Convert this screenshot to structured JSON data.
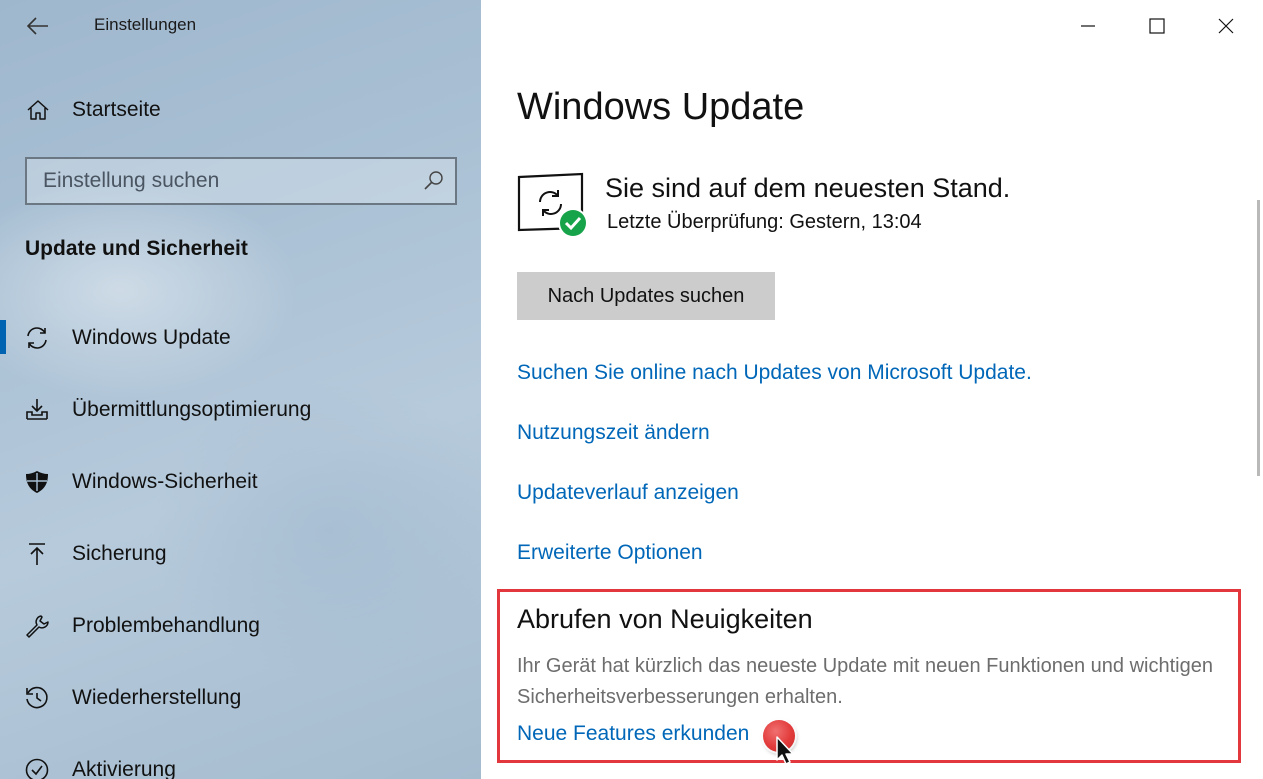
{
  "window": {
    "title": "Einstellungen",
    "controls": [
      "minimize-icon",
      "maximize-icon",
      "close-icon"
    ]
  },
  "sidebar": {
    "back_icon": "arrow-left-icon",
    "home": {
      "label": "Startseite",
      "icon": "home-icon"
    },
    "search": {
      "placeholder": "Einstellung suchen",
      "value": "",
      "icon": "search-icon"
    },
    "section_heading": "Update und Sicherheit",
    "items": [
      {
        "label": "Windows Update",
        "icon": "sync-icon",
        "active": true
      },
      {
        "label": "Übermittlungsoptimierung",
        "icon": "delivery-optimization-icon",
        "active": false
      },
      {
        "label": "Windows-Sicherheit",
        "icon": "shield-icon",
        "active": false
      },
      {
        "label": "Sicherung",
        "icon": "backup-arrow-icon",
        "active": false
      },
      {
        "label": "Problembehandlung",
        "icon": "wrench-icon",
        "active": false
      },
      {
        "label": "Wiederherstellung",
        "icon": "restore-icon",
        "active": false
      },
      {
        "label": "Aktivierung",
        "icon": "check-circle-icon",
        "active": false
      }
    ]
  },
  "main": {
    "title": "Windows Update",
    "status": {
      "icon": "update-status-check-icon",
      "title": "Sie sind auf dem neuesten Stand.",
      "last_check": "Letzte Überprüfung: Gestern, 13:04"
    },
    "check_button": "Nach Updates suchen",
    "links": [
      "Suchen Sie online nach Updates von Microsoft Update.",
      "Nutzungszeit ändern",
      "Updateverlauf anzeigen",
      "Erweiterte Optionen"
    ],
    "news": {
      "title": "Abrufen von Neuigkeiten",
      "text": "Ihr Gerät hat kürzlich das neueste Update mit neuen Funktionen und wichtigen Sicherheitsverbesserungen erhalten.",
      "link": "Neue Features erkunden"
    }
  },
  "colors": {
    "accent": "#0067b8",
    "active_indicator": "#0063b1",
    "highlight_border": "#e2383d",
    "check_green": "#16a34a",
    "button_bg": "#cccccc"
  }
}
